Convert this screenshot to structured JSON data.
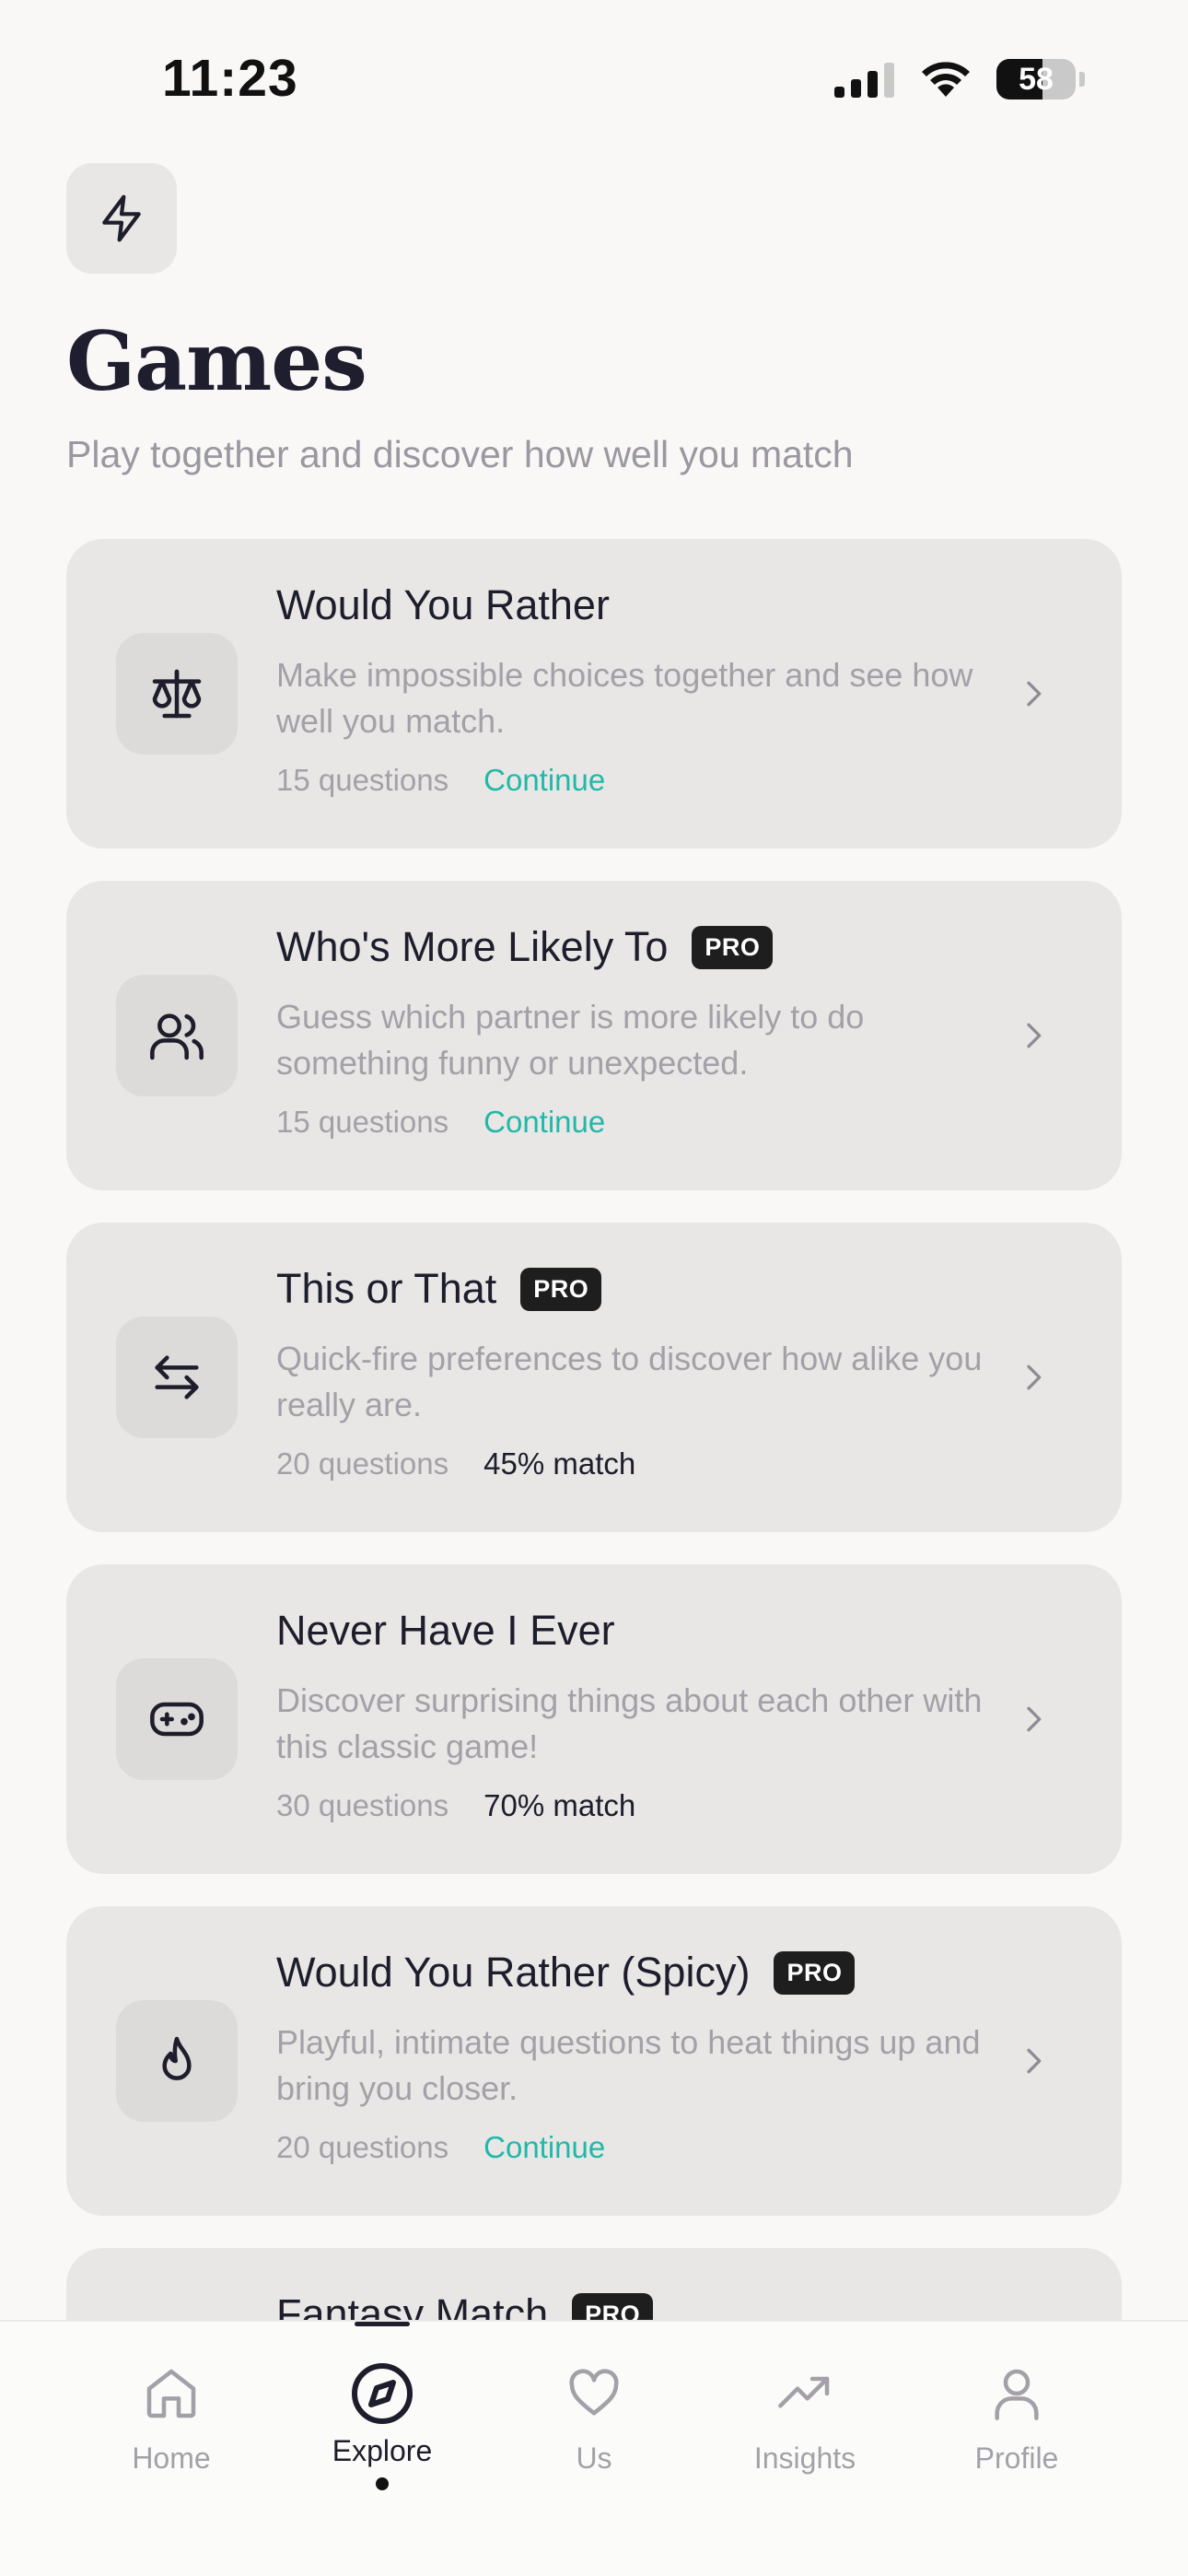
{
  "status_bar": {
    "time": "11:23",
    "battery": "58",
    "battery_level": 0.58
  },
  "header": {
    "icon": "lightning-icon",
    "title": "Games",
    "subtitle": "Play together and discover how well you match"
  },
  "games": [
    {
      "title": "Would You Rather",
      "pro": false,
      "pro_label": "",
      "icon": "scale-icon",
      "description": "Make impossible choices together and see how well you match.",
      "questions": "15 questions",
      "status": "Continue",
      "status_type": "continue"
    },
    {
      "title": "Who's More Likely To",
      "pro": true,
      "pro_label": "PRO",
      "icon": "users-icon",
      "description": "Guess which partner is more likely to do something funny or unexpected.",
      "questions": "15 questions",
      "status": "Continue",
      "status_type": "continue"
    },
    {
      "title": "This or That",
      "pro": true,
      "pro_label": "PRO",
      "icon": "swap-arrows-icon",
      "description": "Quick-fire preferences to discover how alike you really are.",
      "questions": "20 questions",
      "status": "45% match",
      "status_type": "match"
    },
    {
      "title": "Never Have I Ever",
      "pro": false,
      "pro_label": "",
      "icon": "gamepad-icon",
      "description": "Discover surprising things about each other with this classic game!",
      "questions": "30 questions",
      "status": "70% match",
      "status_type": "match"
    },
    {
      "title": "Would You Rather (Spicy)",
      "pro": true,
      "pro_label": "PRO",
      "icon": "flame-icon",
      "description": "Playful, intimate questions to heat things up and bring you closer.",
      "questions": "20 questions",
      "status": "Continue",
      "status_type": "continue"
    },
    {
      "title": "Fantasy Match",
      "pro": true,
      "pro_label": "PRO",
      "icon": "",
      "description": "",
      "questions": "",
      "status": "",
      "status_type": ""
    }
  ],
  "tabs": [
    {
      "label": "Home",
      "icon": "home-icon",
      "active": false
    },
    {
      "label": "Explore",
      "icon": "compass-icon",
      "active": true
    },
    {
      "label": "Us",
      "icon": "heart-icon",
      "active": false
    },
    {
      "label": "Insights",
      "icon": "trending-up-icon",
      "active": false
    },
    {
      "label": "Profile",
      "icon": "user-icon",
      "active": false
    }
  ],
  "colors": {
    "accent": "#22b8a8",
    "card_bg": "#e8e7e6",
    "background": "#f9f8f6",
    "badge_bg": "#1e1e1e"
  }
}
